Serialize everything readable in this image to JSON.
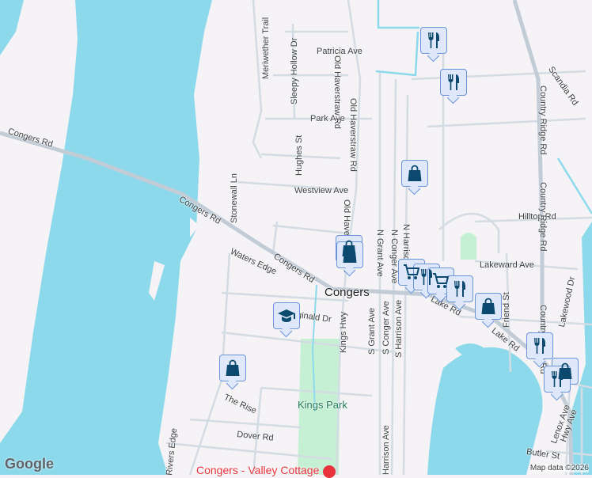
{
  "map": {
    "colors": {
      "water": "#8dd9ec",
      "land": "#f5f3f5",
      "road": "#d3dbe3",
      "park": "#c6f0d4",
      "marker_bg": "#dfe8fb",
      "marker_icon": "#0b4a6e"
    },
    "labels": {
      "congers_rd_1": "Congers Rd",
      "congers_rd_2": "Congers Rd",
      "congers_rd_3": "Congers Rd",
      "meriwether": "Meriwether Trail",
      "sleepy_hollow": "Sleepy Hollow Dr",
      "patricia": "Patricia Ave",
      "park_ave": "Park Ave",
      "hughes": "Hughes St",
      "stonewall": "Stonewall Ln",
      "westview": "Westview Ave",
      "old_haverstraw_1": "Old Haverstraw Rd",
      "old_haverstraw_2": "Old Haverstraw Rd",
      "old_haverstraw_3": "Old Haverstraw Rd",
      "n_grant": "N Grant Ave",
      "n_conger": "N Conger Ave",
      "n_harrison": "N Harrison Ave",
      "waters_edge": "Waters Edge",
      "reginald": "Reginald Dr",
      "kings_hwy": "Kings Hwy",
      "s_grant": "S Grant Ave",
      "s_conger": "S Conger Ave",
      "s_harrison": "S Harrison Ave",
      "harrison": "Harrison Ave",
      "lake_rd_1": "Lake Rd",
      "lake_rd_2": "Lake Rd",
      "friend": "Friend St",
      "lakeward": "Lakeward Ave",
      "hilltop": "Hilltop Rd",
      "scandia": "Scandia Rd",
      "country_ridge_1": "Country Ridge Rd",
      "country_ridge_2": "Country Ridge Rd",
      "country_ridge_3": "Country Ridge Rd",
      "lakewood": "Lakewood Dr",
      "the_rise": "The Rise",
      "dover": "Dover Rd",
      "rivers_edge": "Rivers Edge",
      "lenox": "Lenox Ave",
      "hwy_ave": "Hwy Ave",
      "butler": "Butler St"
    },
    "town": "Congers",
    "park": "Kings Park",
    "poi": "Congers - Valley Cottage",
    "markers": [
      "restaurant",
      "restaurant",
      "shopping-bag",
      "shopping-bag",
      "shopping-bag",
      "cart",
      "restaurant",
      "cart",
      "restaurant",
      "shopping-bag",
      "education",
      "shopping-bag",
      "restaurant",
      "shopping-bag",
      "restaurant"
    ],
    "attribution": "Map data ©2026",
    "logo": "Google"
  }
}
